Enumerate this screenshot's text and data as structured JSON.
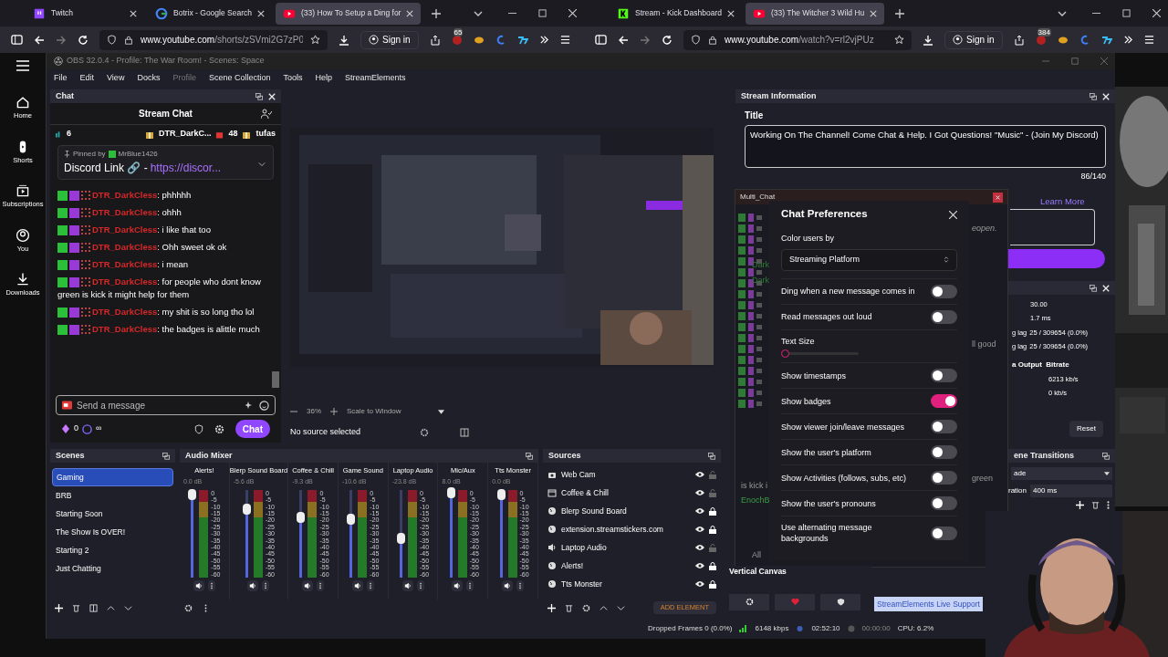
{
  "browsers": [
    {
      "tabs": [
        {
          "label": "Twitch",
          "selected": false
        },
        {
          "label": "Botrix - Google Search",
          "selected": false
        },
        {
          "label": "(33) How To Setup a Ding for",
          "selected": true
        }
      ],
      "url_host": "www.youtube.com",
      "url_path": "/shorts/zSVmi2G7zP0",
      "sign_in": "Sign in",
      "ext_badge": "65"
    },
    {
      "tabs": [
        {
          "label": "Stream - Kick Dashboard",
          "selected": false
        },
        {
          "label": "(33) The Witcher 3 Wild Hu",
          "selected": true
        }
      ],
      "url_host": "www.youtube.com",
      "url_path": "/watch?v=rl2vjPUz",
      "sign_in": "Sign in",
      "ext_badge": "384"
    }
  ],
  "yt_sidebar": [
    {
      "label": "Home"
    },
    {
      "label": "Shorts"
    },
    {
      "label": "Subscriptions"
    },
    {
      "label": "You"
    },
    {
      "label": "Downloads"
    }
  ],
  "obs": {
    "title": "OBS 32.0.4 - Profile: The War Room! - Scenes: Space",
    "menu": [
      {
        "label": "File",
        "disabled": false
      },
      {
        "label": "Edit",
        "disabled": false
      },
      {
        "label": "View",
        "disabled": false
      },
      {
        "label": "Docks",
        "disabled": false
      },
      {
        "label": "Profile",
        "disabled": true
      },
      {
        "label": "Scene Collection",
        "disabled": false
      },
      {
        "label": "Tools",
        "disabled": false
      },
      {
        "label": "Help",
        "disabled": false
      },
      {
        "label": "StreamElements",
        "disabled": false
      }
    ],
    "chat": {
      "dock_title": "Chat",
      "header": "Stream Chat",
      "viewers": "6",
      "gifters": [
        {
          "name": "DTR_DarkC...",
          "count": "48"
        },
        {
          "name": "tufas"
        }
      ],
      "pinned_by": "Pinned by",
      "pinned_user": "MrBlue1426",
      "pinned_text": "Discord Link 🔗 -",
      "pinned_link": "https://discor...",
      "messages": [
        {
          "user": "DTR_DarkCless",
          "text": ": phhhhh"
        },
        {
          "user": "DTR_DarkCless",
          "text": ": ohhh"
        },
        {
          "user": "DTR_DarkCless",
          "text": ": i like that too"
        },
        {
          "user": "DTR_DarkCless",
          "text": ": Ohh sweet ok ok"
        },
        {
          "user": "DTR_DarkCless",
          "text": ": i mean"
        },
        {
          "user": "DTR_DarkCless",
          "text": ": for people who dont know green is kick it might help for them"
        },
        {
          "user": "DTR_DarkCless",
          "text": ": my shit is so long tho lol"
        },
        {
          "user": "DTR_DarkCless",
          "text": ": the badges is alittle much"
        }
      ],
      "input_placeholder": "Send a message",
      "points": "0",
      "infinity": "∞",
      "send": "Chat"
    },
    "preview": {
      "zoom": "36%",
      "scale": "Scale to Window",
      "no_source": "No source selected"
    },
    "stream_info": {
      "dock_title": "Stream Information",
      "title_label": "Title",
      "title_value": "Working On The Channel! Come Chat & Help. I Got Questions! \"Music\" - (Join My Discord)",
      "count": "86/140",
      "learn_more": "Learn More",
      "stats": [
        "30.00",
        "1.7 ms",
        "25 / 309654 (0.0%)",
        "25 / 309654 (0.0%)"
      ],
      "stat_labels": [
        "g lag",
        "g lag"
      ],
      "bitrate_header": "a Output  Bitrate",
      "bitrates": [
        "6213 kb/s",
        "0 kb/s"
      ],
      "reset": "Reset",
      "transitions": "ene Transitions",
      "transition_value": "ade",
      "duration_label": "ration",
      "duration": "400 ms"
    },
    "multi_chat": {
      "title": "Multi_Chat",
      "fragments": [
        "eopen.",
        "ll good",
        "green",
        "is kick i",
        "EnochB",
        "All"
      ],
      "names": [
        "Dark",
        "Dark"
      ]
    },
    "prefs": {
      "title": "Chat Preferences",
      "color_label": "Color users by",
      "color_value": "Streaming Platform",
      "text_size_label": "Text Size",
      "text_size": {
        "level": 0
      },
      "toggles_top": [
        {
          "label": "Ding when a new message comes in",
          "on": false
        },
        {
          "label": "Read messages out loud",
          "on": false
        }
      ],
      "toggles": [
        {
          "label": "Show timestamps",
          "on": false
        },
        {
          "label": "Show badges",
          "on": true
        },
        {
          "label": "Show viewer join/leave messages",
          "on": false
        },
        {
          "label": "Show the user's platform",
          "on": false
        },
        {
          "label": "Show Activities (follows, subs, etc)",
          "on": false
        },
        {
          "label": "Show the user's pronouns",
          "on": false
        },
        {
          "label": "Use alternating message backgrounds",
          "on": false
        }
      ]
    },
    "scenes": {
      "title": "Scenes",
      "items": [
        {
          "label": "Gaming",
          "selected": true
        },
        {
          "label": "BRB",
          "selected": false
        },
        {
          "label": "Starting Soon",
          "selected": false
        },
        {
          "label": "The Show Is OVER!",
          "selected": false
        },
        {
          "label": "Starting 2",
          "selected": false
        },
        {
          "label": "Just Chatting",
          "selected": false
        }
      ]
    },
    "mixer": {
      "title": "Audio Mixer",
      "channels": [
        {
          "name": "Alerts!",
          "db": "0.0 dB",
          "level": 0.95,
          "scale": [
            "0",
            "-5",
            "-10",
            "-15",
            "-20",
            "-25",
            "-30",
            "-35",
            "-40",
            "-45",
            "-50",
            "-55",
            "-60"
          ]
        },
        {
          "name": "Blerp Sound Board",
          "db": "-5.6 dB",
          "level": 0.78,
          "scale": [
            "0",
            "-5",
            "-10",
            "-15",
            "-20",
            "-25",
            "-30",
            "-35",
            "-40",
            "-45",
            "-50",
            "-55",
            "-60"
          ]
        },
        {
          "name": "Coffee & Chill",
          "db": "-9.3 dB",
          "level": 0.68,
          "scale": [
            "0",
            "-5",
            "-10",
            "-15",
            "-20",
            "-25",
            "-30",
            "-35",
            "-40",
            "-45",
            "-50",
            "-55",
            "-60"
          ]
        },
        {
          "name": "Game Sound",
          "db": "-10.6 dB",
          "level": 0.66,
          "scale": [
            "0",
            "-5",
            "-10",
            "-15",
            "-20",
            "-25",
            "-30",
            "-35",
            "-40",
            "-45",
            "-50",
            "-55",
            "-60"
          ]
        },
        {
          "name": "Laptop Audio",
          "db": "-23.8 dB",
          "level": 0.45,
          "scale": [
            "0",
            "-5",
            "-10",
            "-15",
            "-20",
            "-25",
            "-30",
            "-35",
            "-40",
            "-45",
            "-50",
            "-55",
            "-60"
          ]
        },
        {
          "name": "Mic/Aux",
          "db": "8.0 dB",
          "level": 0.97,
          "scale": [
            "0",
            "-5",
            "-10",
            "-15",
            "-20",
            "-25",
            "-30",
            "-35",
            "-40",
            "-45",
            "-50",
            "-55",
            "-60"
          ]
        },
        {
          "name": "Tts Monster",
          "db": "0.0 dB",
          "level": 0.95,
          "scale": [
            "0",
            "-5",
            "-10",
            "-15",
            "-20",
            "-25",
            "-30",
            "-35",
            "-40",
            "-45",
            "-50",
            "-55",
            "-60"
          ]
        }
      ]
    },
    "sources": {
      "title": "Sources",
      "add": "ADD ELEMENT",
      "items": [
        {
          "label": "Web Cam",
          "kind": "camera",
          "locked": false
        },
        {
          "label": "Coffee & Chill",
          "kind": "window",
          "locked": false
        },
        {
          "label": "Blerp Sound Board",
          "kind": "browser",
          "locked": true
        },
        {
          "label": "extension.streamstickers.com",
          "kind": "browser",
          "locked": true
        },
        {
          "label": "Laptop Audio",
          "kind": "audio",
          "locked": false
        },
        {
          "label": "Alerts!",
          "kind": "browser",
          "locked": true
        },
        {
          "label": "Tts Monster",
          "kind": "browser",
          "locked": true
        }
      ]
    },
    "vertical_canvas": "Vertical Canvas",
    "support": "StreamElements Live Support",
    "status": {
      "dropped": "Dropped Frames 0 (0.0%)",
      "kbps": "6148 kbps",
      "live": "02:52:10",
      "rec": "00:00:00",
      "cpu": "CPU: 6.2%"
    }
  }
}
